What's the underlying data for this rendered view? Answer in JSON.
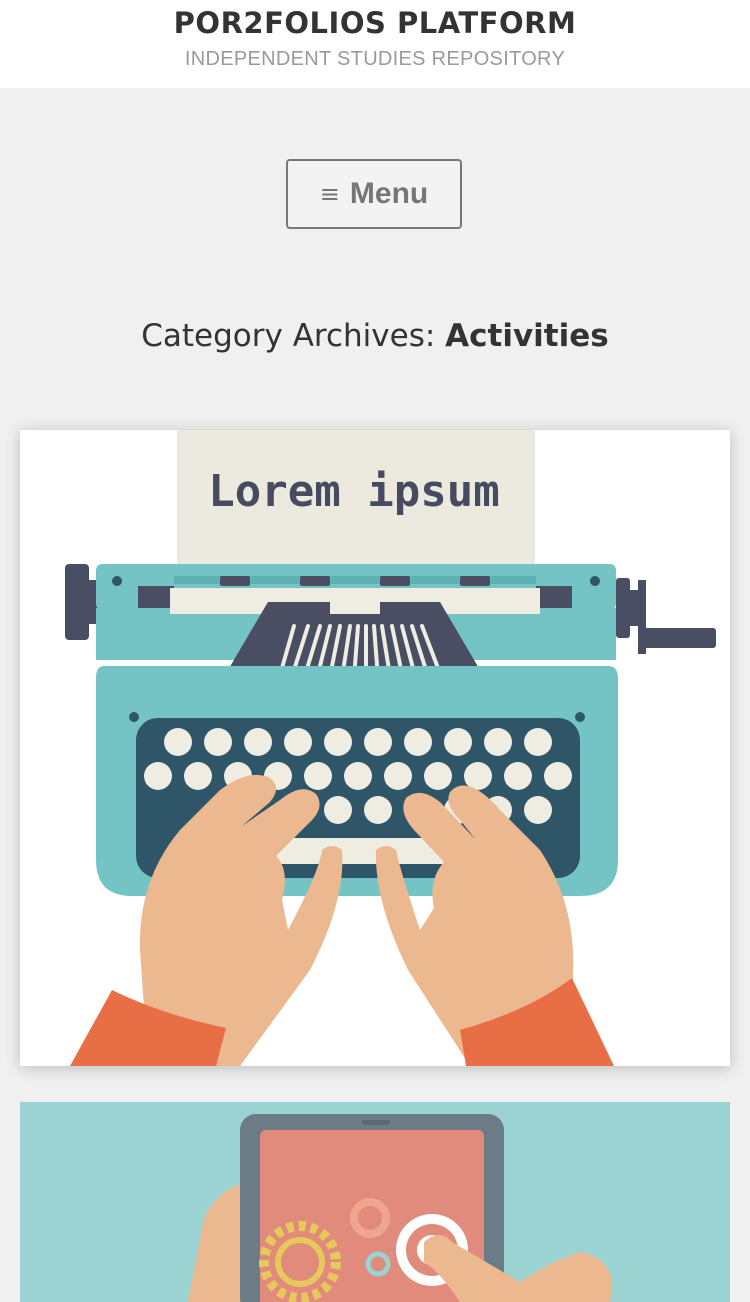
{
  "header": {
    "site_title": "POR2FOLIOS PLATFORM",
    "tagline": "INDEPENDENT STUDIES REPOSITORY"
  },
  "nav": {
    "menu_icon": "hamburger-icon",
    "menu_label": "Menu"
  },
  "archive": {
    "prefix": "Category Archives:",
    "category": "Activities"
  },
  "posts": [
    {
      "image": "typewriter-illustration",
      "image_text": "Lorem ipsum"
    },
    {
      "image": "tablet-gears-illustration"
    }
  ],
  "colors": {
    "page_bg": "#f0f0f0",
    "teal": "#74c4c6",
    "navy": "#4a4e63",
    "key_cream": "#efece2",
    "skin": "#ebb88f",
    "sleeve": "#e86f45",
    "paper": "#ece9df"
  }
}
